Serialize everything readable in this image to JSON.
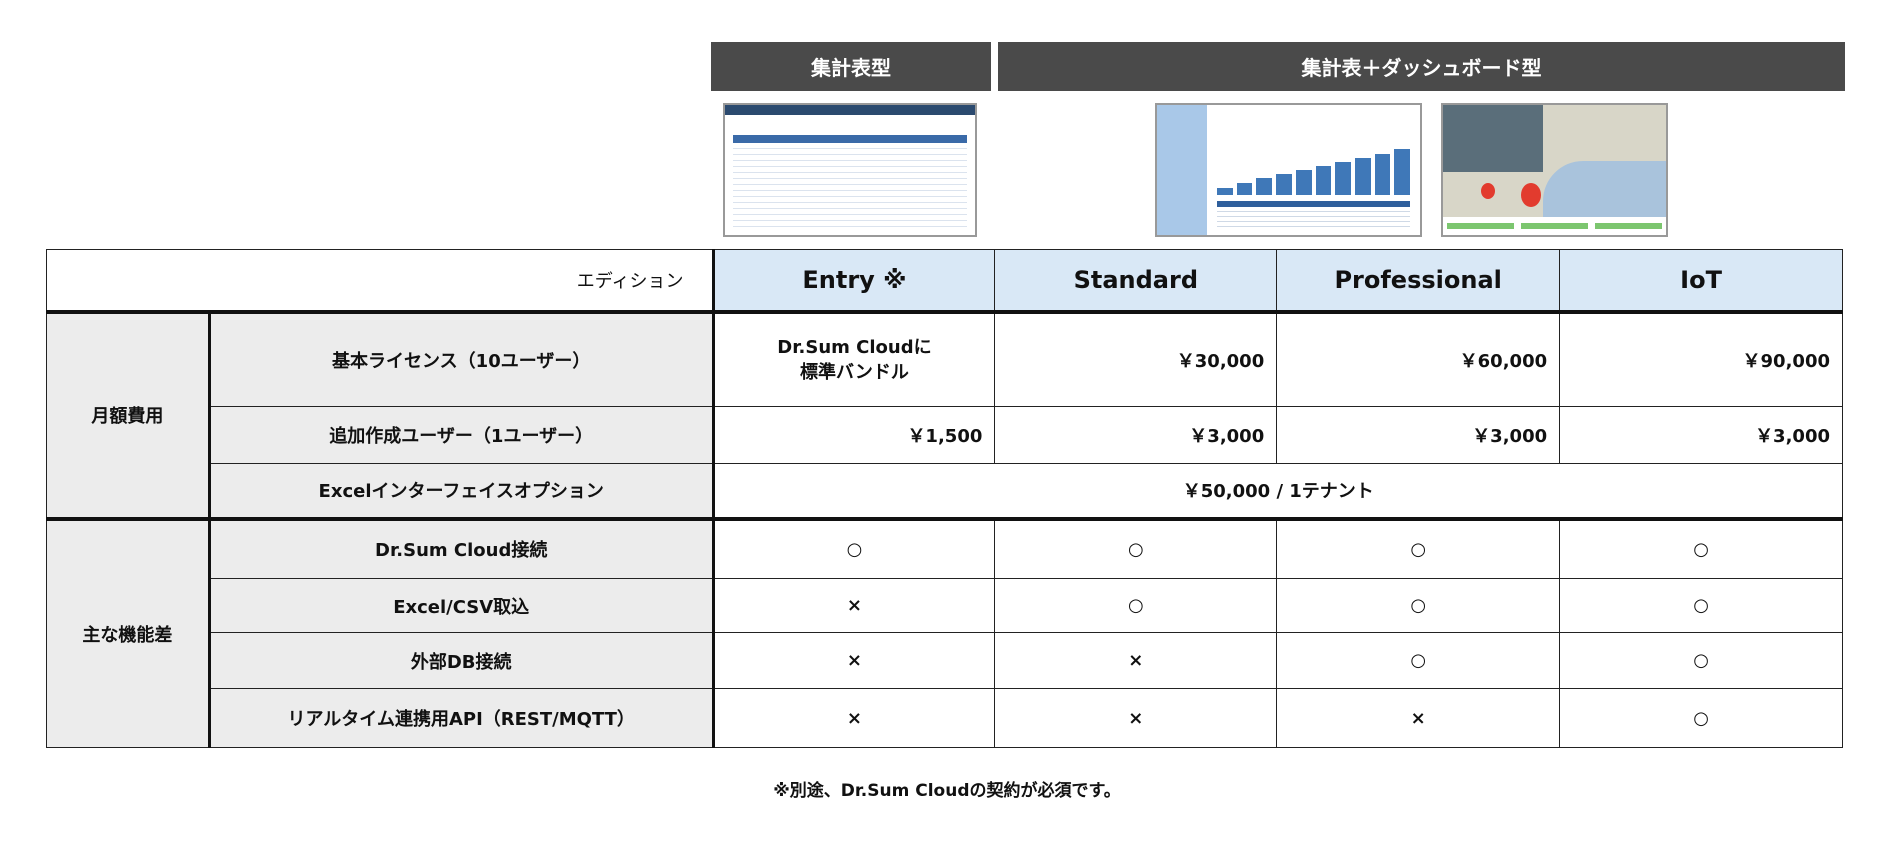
{
  "categories": {
    "table_type": "集計表型",
    "dashboard_type": "集計表＋ダッシュボード型"
  },
  "table": {
    "edition_label": "エディション",
    "editions": [
      "Entry ※",
      "Standard",
      "Professional",
      "IoT"
    ],
    "monthly": {
      "group": "月額費用",
      "rows": [
        {
          "label": "基本ライセンス（10ユーザー）",
          "values": [
            "Dr.Sum Cloudに\n標準バンドル",
            "￥30,000",
            "￥60,000",
            "￥90,000"
          ]
        },
        {
          "label": "追加作成ユーザー（1ユーザー）",
          "values": [
            "￥1,500",
            "￥3,000",
            "￥3,000",
            "￥3,000"
          ]
        },
        {
          "label": "Excelインターフェイスオプション",
          "value": "￥50,000 / 1テナント"
        }
      ]
    },
    "features": {
      "group": "主な機能差",
      "rows": [
        {
          "label": "Dr.Sum Cloud接続",
          "values": [
            "○",
            "○",
            "○",
            "○"
          ]
        },
        {
          "label": "Excel/CSV取込",
          "values": [
            "×",
            "○",
            "○",
            "○"
          ]
        },
        {
          "label": "外部DB接続",
          "values": [
            "×",
            "×",
            "○",
            "○"
          ]
        },
        {
          "label": "リアルタイム連携用API（REST/MQTT）",
          "values": [
            "×",
            "×",
            "×",
            "○"
          ]
        }
      ]
    }
  },
  "footnote": "※別途、Dr.Sum Cloudの契約が必須です。"
}
